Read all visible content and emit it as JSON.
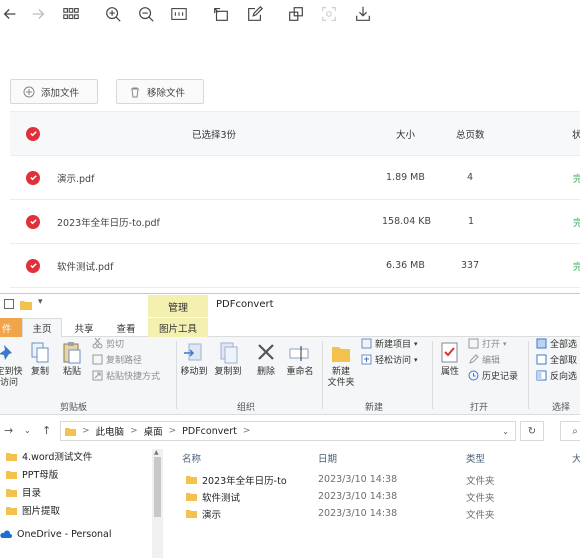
{
  "toolbar": {
    "icons": [
      "back-arrow-icon",
      "forward-arrow-icon",
      "grid-view-icon",
      "zoom-in-icon",
      "zoom-out-icon",
      "fit-width-icon",
      "rotate-icon",
      "edit-icon",
      "crop-icon",
      "scan-icon",
      "download-icon"
    ]
  },
  "actions": {
    "add_file": "添加文件",
    "remove_file": "移除文件"
  },
  "table": {
    "header": {
      "selected": "已选择3份",
      "size": "大小",
      "pages": "总页数",
      "status": "状"
    },
    "rows": [
      {
        "name": "演示.pdf",
        "size": "1.89 MB",
        "pages": "4",
        "status": "完"
      },
      {
        "name": "2023年全年日历-to.pdf",
        "size": "158.04 KB",
        "pages": "1",
        "status": "完"
      },
      {
        "name": "软件测试.pdf",
        "size": "6.36 MB",
        "pages": "337",
        "status": "完"
      }
    ]
  },
  "explorer": {
    "context_tab": "管理",
    "window_title": "PDFconvert",
    "tabs": {
      "file": "件",
      "home": "主页",
      "share": "共享",
      "view": "查看",
      "picture_tools": "图片工具"
    },
    "ribbon": {
      "pin": "定到快\n访问",
      "copy": "复制",
      "paste": "粘贴",
      "cut": "剪切",
      "copy_path": "复制路径",
      "paste_shortcut": "粘贴快捷方式",
      "clipboard_group": "剪贴板",
      "move_to": "移动到",
      "copy_to": "复制到",
      "delete": "删除",
      "rename": "重命名",
      "organize_group": "组织",
      "new_folder": "新建\n文件夹",
      "new_item": "新建项目",
      "easy_access": "轻松访问",
      "new_group": "新建",
      "properties": "属性",
      "open": "打开",
      "edit": "编辑",
      "history": "历史记录",
      "open_group": "打开",
      "select_all": "全部选",
      "select_none": "全部取",
      "invert": "反向选",
      "select_group": "选择"
    },
    "address": {
      "crumbs": [
        "此电脑",
        "桌面",
        "PDFconvert"
      ]
    },
    "nav_items": [
      {
        "label": "4.word测试文件"
      },
      {
        "label": "PPT母版"
      },
      {
        "label": "目录"
      },
      {
        "label": "图片提取"
      },
      {
        "label": "OneDrive - Personal"
      }
    ],
    "columns": {
      "name": "名称",
      "date": "日期",
      "type": "类型",
      "size": "大"
    },
    "files": [
      {
        "name": "2023年全年日历-to",
        "date": "2023/3/10 14:38",
        "type": "文件夹"
      },
      {
        "name": "软件测试",
        "date": "2023/3/10 14:38",
        "type": "文件夹"
      },
      {
        "name": "演示",
        "date": "2023/3/10 14:38",
        "type": "文件夹"
      }
    ]
  },
  "colors": {
    "check_red": "#e0303a",
    "status_green": "#2fa84f",
    "context_tab_yellow": "#f4f0b0",
    "file_tab_orange": "#f2a44a",
    "folder_yellow": "#f2c14e"
  }
}
